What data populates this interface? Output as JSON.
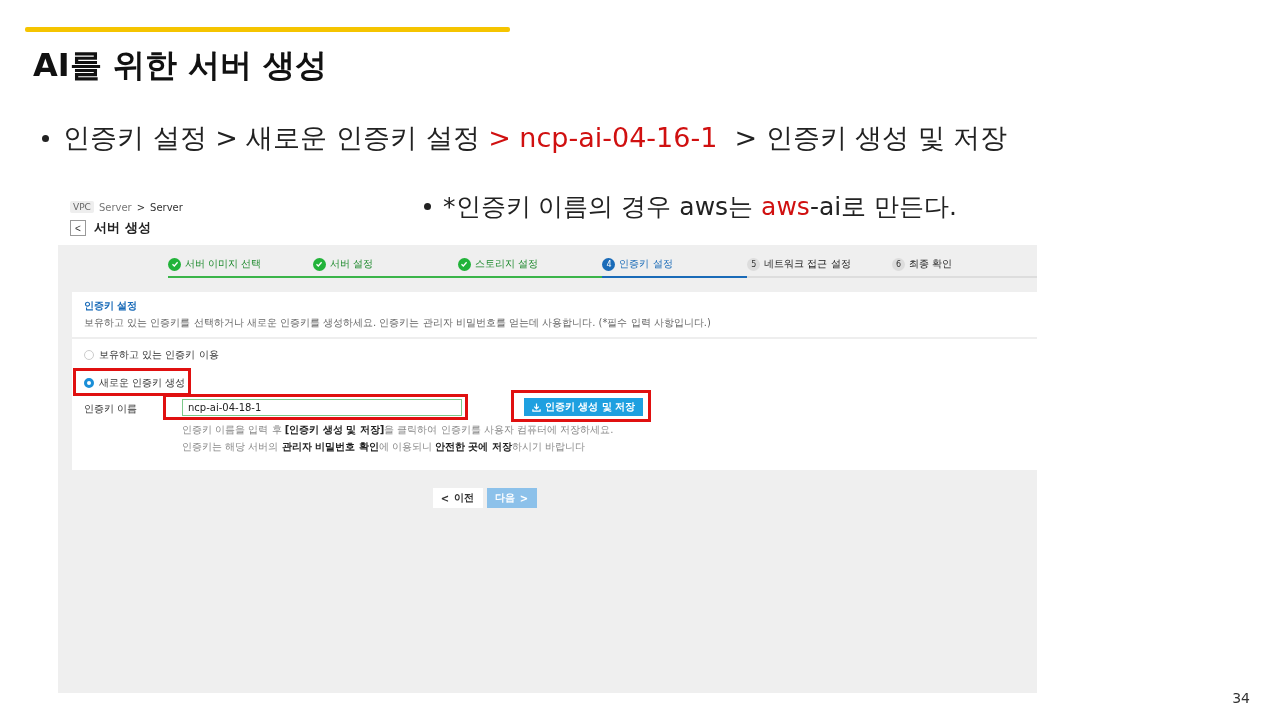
{
  "slide": {
    "title": "AI를 위한 서버 생성",
    "number": "34"
  },
  "bullets": [
    {
      "parts": [
        {
          "text": "인증키 설정 > 새로운 인증키 설정 ",
          "highlight": false
        },
        {
          "text": "> ncp-ai-04-16-1",
          "highlight": true
        },
        {
          "text": "  > 인증키 생성 및 저장",
          "highlight": false
        }
      ]
    },
    {
      "parts": [
        {
          "text": "*인증키 이름의 경우 aws는 ",
          "highlight": false
        },
        {
          "text": "aws",
          "highlight": true
        },
        {
          "text": "-ai로 만든다.",
          "highlight": false
        }
      ]
    }
  ],
  "screen": {
    "breadcrumb": {
      "tag": "VPC",
      "parent": "Server",
      "separator": ">",
      "current": "Server"
    },
    "back_icon": "<",
    "page_title": "서버 생성",
    "steps": [
      {
        "label": "서버 이미지 선택",
        "completed": true,
        "selected": false
      },
      {
        "label": "서버 설정",
        "completed": true,
        "selected": false
      },
      {
        "label": "스토리지 설정",
        "completed": true,
        "selected": false
      },
      {
        "marker": "4",
        "label": "인증키 설정",
        "completed": false,
        "selected": true
      },
      {
        "marker": "5",
        "label": "네트워크 접근 설정",
        "completed": false,
        "selected": false
      },
      {
        "marker": "6",
        "label": "최종 확인",
        "completed": false,
        "selected": false
      }
    ],
    "panel": {
      "title": "인증키 설정",
      "description": "보유하고 있는 인증키를 선택하거나 새로운 인증키를 생성하세요. 인증키는 관리자 비밀번호를 얻는데 사용합니다. (*필수 입력 사항입니다.)",
      "options": [
        {
          "label": "보유하고 있는 인증키 이용",
          "selected": false,
          "highlighted": false
        },
        {
          "label": "새로운 인증키 생성",
          "selected": true,
          "highlighted": true
        }
      ],
      "field": {
        "label": "인증키 이름",
        "value": "ncp-ai-04-18-1",
        "highlighted": true
      },
      "action": {
        "label": "인증키 생성 및 저장",
        "highlighted": true
      },
      "help": [
        "인증키 이름을 입력 후 **[인증키 생성 및 저장]**을 클릭하여 인증키를 사용자 컴퓨터에 저장하세요.",
        "인증키는 해당 서버의 **관리자 비밀번호 확인**에 이용되니 **안전한 곳에 저장**하시기 바랍니다"
      ]
    },
    "nav": [
      {
        "label": "이전",
        "icon": "<",
        "disabled": false
      },
      {
        "label": "다음",
        "icon": ">",
        "disabled": true
      }
    ]
  }
}
